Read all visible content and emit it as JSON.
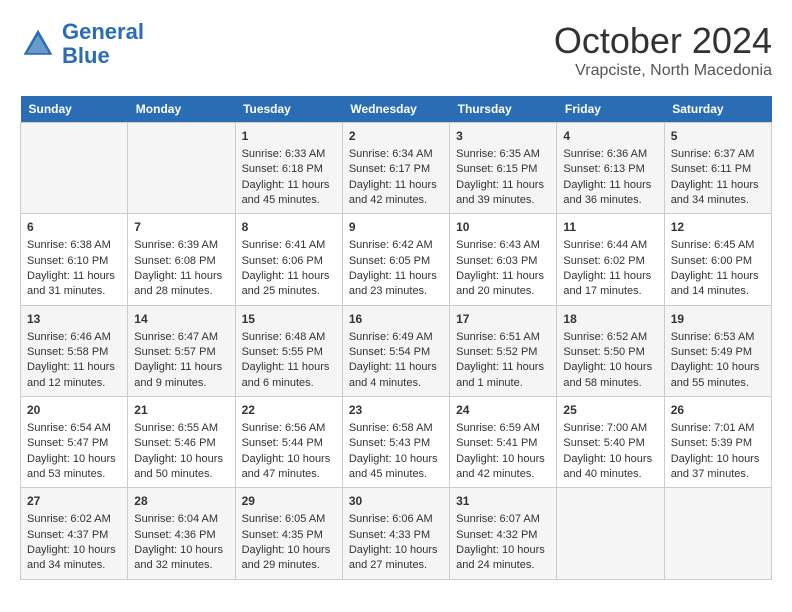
{
  "header": {
    "logo_line1": "General",
    "logo_line2": "Blue",
    "month": "October 2024",
    "location": "Vrapciste, North Macedonia"
  },
  "days_of_week": [
    "Sunday",
    "Monday",
    "Tuesday",
    "Wednesday",
    "Thursday",
    "Friday",
    "Saturday"
  ],
  "weeks": [
    [
      {
        "day": "",
        "content": ""
      },
      {
        "day": "",
        "content": ""
      },
      {
        "day": "1",
        "content": "Sunrise: 6:33 AM\nSunset: 6:18 PM\nDaylight: 11 hours and 45 minutes."
      },
      {
        "day": "2",
        "content": "Sunrise: 6:34 AM\nSunset: 6:17 PM\nDaylight: 11 hours and 42 minutes."
      },
      {
        "day": "3",
        "content": "Sunrise: 6:35 AM\nSunset: 6:15 PM\nDaylight: 11 hours and 39 minutes."
      },
      {
        "day": "4",
        "content": "Sunrise: 6:36 AM\nSunset: 6:13 PM\nDaylight: 11 hours and 36 minutes."
      },
      {
        "day": "5",
        "content": "Sunrise: 6:37 AM\nSunset: 6:11 PM\nDaylight: 11 hours and 34 minutes."
      }
    ],
    [
      {
        "day": "6",
        "content": "Sunrise: 6:38 AM\nSunset: 6:10 PM\nDaylight: 11 hours and 31 minutes."
      },
      {
        "day": "7",
        "content": "Sunrise: 6:39 AM\nSunset: 6:08 PM\nDaylight: 11 hours and 28 minutes."
      },
      {
        "day": "8",
        "content": "Sunrise: 6:41 AM\nSunset: 6:06 PM\nDaylight: 11 hours and 25 minutes."
      },
      {
        "day": "9",
        "content": "Sunrise: 6:42 AM\nSunset: 6:05 PM\nDaylight: 11 hours and 23 minutes."
      },
      {
        "day": "10",
        "content": "Sunrise: 6:43 AM\nSunset: 6:03 PM\nDaylight: 11 hours and 20 minutes."
      },
      {
        "day": "11",
        "content": "Sunrise: 6:44 AM\nSunset: 6:02 PM\nDaylight: 11 hours and 17 minutes."
      },
      {
        "day": "12",
        "content": "Sunrise: 6:45 AM\nSunset: 6:00 PM\nDaylight: 11 hours and 14 minutes."
      }
    ],
    [
      {
        "day": "13",
        "content": "Sunrise: 6:46 AM\nSunset: 5:58 PM\nDaylight: 11 hours and 12 minutes."
      },
      {
        "day": "14",
        "content": "Sunrise: 6:47 AM\nSunset: 5:57 PM\nDaylight: 11 hours and 9 minutes."
      },
      {
        "day": "15",
        "content": "Sunrise: 6:48 AM\nSunset: 5:55 PM\nDaylight: 11 hours and 6 minutes."
      },
      {
        "day": "16",
        "content": "Sunrise: 6:49 AM\nSunset: 5:54 PM\nDaylight: 11 hours and 4 minutes."
      },
      {
        "day": "17",
        "content": "Sunrise: 6:51 AM\nSunset: 5:52 PM\nDaylight: 11 hours and 1 minute."
      },
      {
        "day": "18",
        "content": "Sunrise: 6:52 AM\nSunset: 5:50 PM\nDaylight: 10 hours and 58 minutes."
      },
      {
        "day": "19",
        "content": "Sunrise: 6:53 AM\nSunset: 5:49 PM\nDaylight: 10 hours and 55 minutes."
      }
    ],
    [
      {
        "day": "20",
        "content": "Sunrise: 6:54 AM\nSunset: 5:47 PM\nDaylight: 10 hours and 53 minutes."
      },
      {
        "day": "21",
        "content": "Sunrise: 6:55 AM\nSunset: 5:46 PM\nDaylight: 10 hours and 50 minutes."
      },
      {
        "day": "22",
        "content": "Sunrise: 6:56 AM\nSunset: 5:44 PM\nDaylight: 10 hours and 47 minutes."
      },
      {
        "day": "23",
        "content": "Sunrise: 6:58 AM\nSunset: 5:43 PM\nDaylight: 10 hours and 45 minutes."
      },
      {
        "day": "24",
        "content": "Sunrise: 6:59 AM\nSunset: 5:41 PM\nDaylight: 10 hours and 42 minutes."
      },
      {
        "day": "25",
        "content": "Sunrise: 7:00 AM\nSunset: 5:40 PM\nDaylight: 10 hours and 40 minutes."
      },
      {
        "day": "26",
        "content": "Sunrise: 7:01 AM\nSunset: 5:39 PM\nDaylight: 10 hours and 37 minutes."
      }
    ],
    [
      {
        "day": "27",
        "content": "Sunrise: 6:02 AM\nSunset: 4:37 PM\nDaylight: 10 hours and 34 minutes."
      },
      {
        "day": "28",
        "content": "Sunrise: 6:04 AM\nSunset: 4:36 PM\nDaylight: 10 hours and 32 minutes."
      },
      {
        "day": "29",
        "content": "Sunrise: 6:05 AM\nSunset: 4:35 PM\nDaylight: 10 hours and 29 minutes."
      },
      {
        "day": "30",
        "content": "Sunrise: 6:06 AM\nSunset: 4:33 PM\nDaylight: 10 hours and 27 minutes."
      },
      {
        "day": "31",
        "content": "Sunrise: 6:07 AM\nSunset: 4:32 PM\nDaylight: 10 hours and 24 minutes."
      },
      {
        "day": "",
        "content": ""
      },
      {
        "day": "",
        "content": ""
      }
    ]
  ]
}
